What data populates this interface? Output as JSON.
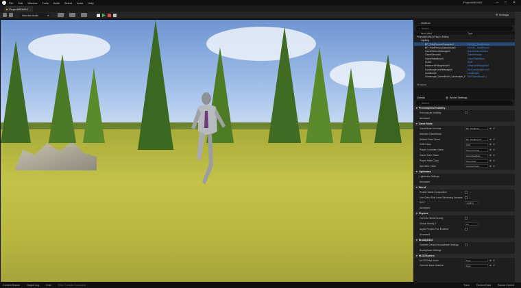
{
  "menu": {
    "items": [
      "File",
      "Edit",
      "Window",
      "Tools",
      "Build",
      "Select",
      "Actor",
      "Help"
    ]
  },
  "window": {
    "title": "ProjectMEANIZ",
    "project_tab": "ProjectMEANIZ",
    "settings_label": "Settings"
  },
  "toolbar": {
    "selection_mode": "Selection Mode"
  },
  "outliner": {
    "tab": "Outliner",
    "search_placeholder": "Search...",
    "col_label": "Item Label",
    "col_type": "Type",
    "rows": [
      {
        "label": "ProjectMEANIZ (Play In Editor)",
        "type": ""
      },
      {
        "label": "Lighting",
        "type": ""
      },
      {
        "label": "BP_ThirdPersonCharacter0",
        "type": "Edit BP_ThirdPerson"
      },
      {
        "label": "BP_ThirdPersonGameMode0",
        "type": "Edit BP_ThirdPerson"
      },
      {
        "label": "GameNetworkManager0",
        "type": "GameNetworkMana"
      },
      {
        "label": "GameSession0",
        "type": "GameSession"
      },
      {
        "label": "GameStateBase0",
        "type": "GameStateBase"
      },
      {
        "label": "HUD0",
        "type": "HUD"
      },
      {
        "label": "InstancedFoliageActor0",
        "type": "InstancedFoliageAct"
      },
      {
        "label": "LandscapeLevelManager0",
        "type": "Edit LandscapeLevel"
      },
      {
        "label": "Landscape",
        "type": "Landscape"
      },
      {
        "label": "Landscape_GameBrush_Landscape_0",
        "type": "Edit GameBrush_L"
      }
    ],
    "count": "48 actors"
  },
  "details": {
    "tabs": [
      "Details",
      "World Settings"
    ],
    "search_placeholder": "Search",
    "sections": [
      {
        "title": "Precomputed Visibility",
        "props": [
          {
            "name": "Precompute Visibility",
            "kind": "check"
          },
          {
            "name": "Advanced",
            "kind": "sub"
          }
        ]
      },
      {
        "title": "Game Mode",
        "props": [
          {
            "name": "GameMode Override",
            "kind": "ddl",
            "value": "BP_ThirdPerso"
          },
          {
            "name": "Selected GameMode",
            "kind": "sub"
          },
          {
            "name": "Default Pawn Class",
            "kind": "ddl",
            "value": "BP_ThirdPersonC"
          },
          {
            "name": "HUD Class",
            "kind": "ddl",
            "value": "HUD"
          },
          {
            "name": "Player Controller Class",
            "kind": "ddl",
            "value": "PlayerControlle"
          },
          {
            "name": "Game State Class",
            "kind": "ddl",
            "value": "GameStateBase"
          },
          {
            "name": "Player State Class",
            "kind": "ddl",
            "value": "PlayerState"
          },
          {
            "name": "Spectator Class",
            "kind": "ddl",
            "value": "SpectatorPawn"
          }
        ]
      },
      {
        "title": "Lightmass",
        "props": [
          {
            "name": "Lightmass Settings",
            "kind": "sub"
          },
          {
            "name": "Advanced",
            "kind": "sub"
          }
        ]
      },
      {
        "title": "World",
        "props": [
          {
            "name": "Enable World Composition",
            "kind": "check"
          },
          {
            "name": "Use Client Side Level Streaming Volumes",
            "kind": "check"
          },
          {
            "name": "Kill Z",
            "kind": "num",
            "value": "-10480.0"
          },
          {
            "name": "Advanced",
            "kind": "sub"
          }
        ]
      },
      {
        "title": "Physics",
        "props": [
          {
            "name": "Override World Gravity",
            "kind": "check"
          },
          {
            "name": "Global Gravity Z",
            "kind": "num",
            "value": "0.0"
          },
          {
            "name": "Async Physics Tick Enabled",
            "kind": "check"
          },
          {
            "name": "Advanced",
            "kind": "sub"
          }
        ]
      },
      {
        "title": "Broadphase",
        "props": [
          {
            "name": "Override Default Broadphase Settings",
            "kind": "check"
          },
          {
            "name": "Broadphase Settings",
            "kind": "sub"
          }
        ]
      },
      {
        "title": "HLODSystem",
        "props": [
          {
            "name": "HLODSetup Asset",
            "kind": "ddl",
            "value": "None"
          },
          {
            "name": "Override Base Material",
            "kind": "ddl",
            "value": "None"
          }
        ]
      }
    ]
  },
  "status": {
    "items": [
      "Content Drawer",
      "Output Log",
      "Cmd",
      "Enter Console Command"
    ],
    "right": [
      "Derived Data",
      "Source Control"
    ],
    "trace": "Trace"
  }
}
